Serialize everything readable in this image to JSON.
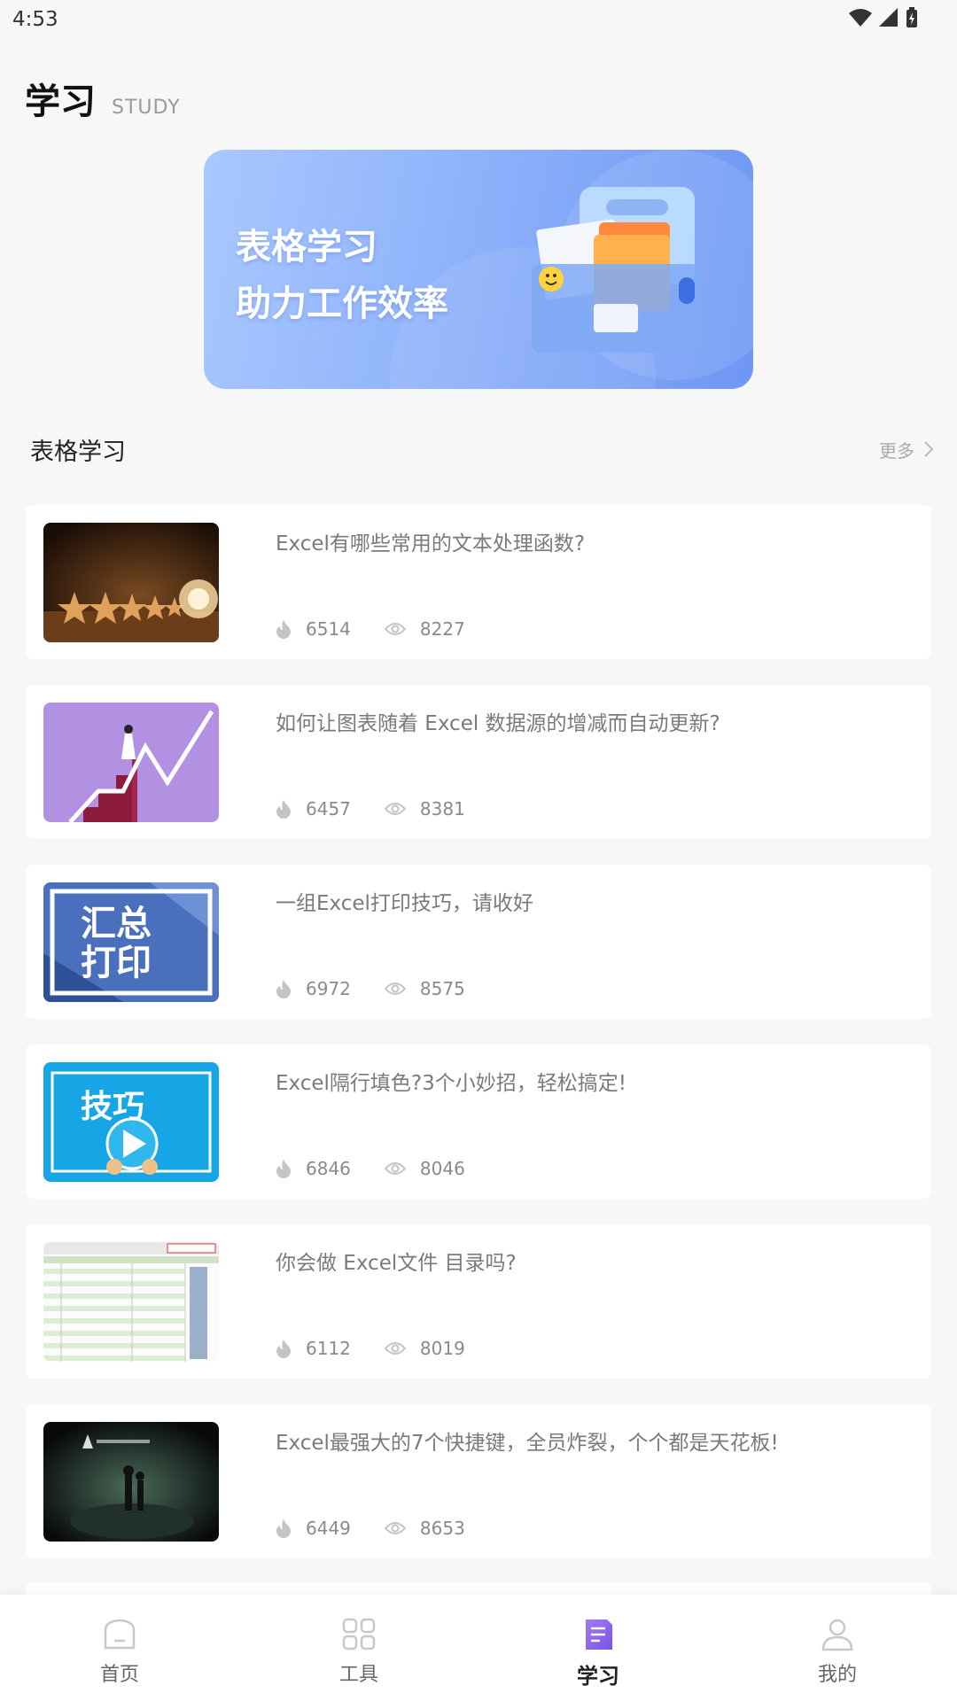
{
  "status_bar": {
    "time": "4:53"
  },
  "header": {
    "title": "学习",
    "subtitle": "STUDY"
  },
  "banner": {
    "line1": "表格学习",
    "line2": "助力工作效率"
  },
  "section": {
    "title": "表格学习",
    "more": "更多"
  },
  "articles": [
    {
      "title": "Excel有哪些常用的文本处理函数?",
      "likes": "6514",
      "views": "8227",
      "thumb": "stars-lightbulb"
    },
    {
      "title": "如何让图表随着 Excel 数据源的增减而自动更新?",
      "likes": "6457",
      "views": "8381",
      "thumb": "growth-chart"
    },
    {
      "title": "一组Excel打印技巧，请收好",
      "likes": "6972",
      "views": "8575",
      "thumb": "summary-print",
      "thumb_text_1": "汇总",
      "thumb_text_2": "打印"
    },
    {
      "title": "Excel隔行填色?3个小妙招，轻松搞定!",
      "likes": "6846",
      "views": "8046",
      "thumb": "tips-video",
      "thumb_text_1": "技巧"
    },
    {
      "title": "你会做 Excel文件 目录吗?",
      "likes": "6112",
      "views": "8019",
      "thumb": "spreadsheet"
    },
    {
      "title": "Excel最强大的7个快捷键，全员炸裂，个个都是天花板!",
      "likes": "6449",
      "views": "8653",
      "thumb": "dark-cave"
    }
  ],
  "bottom_nav": [
    {
      "label": "首页",
      "icon": "home-icon",
      "active": false
    },
    {
      "label": "工具",
      "icon": "grid-icon",
      "active": false
    },
    {
      "label": "学习",
      "icon": "document-icon",
      "active": true
    },
    {
      "label": "我的",
      "icon": "user-icon",
      "active": false
    }
  ],
  "colors": {
    "accent": "#8a64f0",
    "banner_start": "#a9c8ff",
    "banner_end": "#6e97f4"
  }
}
